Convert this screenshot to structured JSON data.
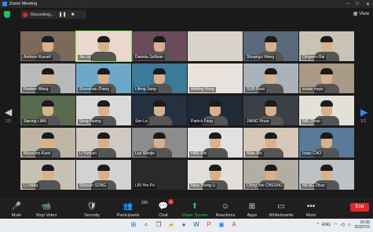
{
  "window": {
    "title": "Zoom Meeting",
    "controls": [
      "–",
      "□",
      "✕"
    ]
  },
  "recording": {
    "label": "Recording...",
    "view": "View"
  },
  "pager": {
    "left": "1/3",
    "right": "1/3"
  },
  "participants": [
    {
      "name": "Andrew Russell"
    },
    {
      "name": "Jie Liu"
    },
    {
      "name": "Daniela Sullivan"
    },
    {
      "name": ""
    },
    {
      "name": "Shuangyi Wang"
    },
    {
      "name": "Qingwen Bai"
    },
    {
      "name": "Ruimen Wang"
    },
    {
      "name": "Shanshan Zhang"
    },
    {
      "name": "Lifeng Jiang"
    },
    {
      "name": "Weiling Hong"
    },
    {
      "name": "SUN Ruixi"
    },
    {
      "name": "susan mays"
    },
    {
      "name": "Jiarong LIAN"
    },
    {
      "name": "Song Huang"
    },
    {
      "name": "Son Le"
    },
    {
      "name": "Patrick Fang"
    },
    {
      "name": "JIANG Yinuo"
    },
    {
      "name": "NIE Cihao"
    },
    {
      "name": "Miyazono Kaori"
    },
    {
      "name": "Li Yunyan"
    },
    {
      "name": "Luo Wenjie"
    },
    {
      "name": "HAN Wei"
    },
    {
      "name": "Allas Wu"
    },
    {
      "name": "Isaac CAO"
    },
    {
      "name": "Li Xiang"
    },
    {
      "name": "Shiyuan SONG"
    },
    {
      "name": "LIN Yen Po"
    },
    {
      "name": "Nora Yitong Li"
    },
    {
      "name": "Ching Yee CHEUNG"
    },
    {
      "name": "MENG Zihan"
    }
  ],
  "toolbar": {
    "mute": "Mute",
    "video": "Stop Video",
    "security": "Security",
    "participants": "Participants",
    "participants_count": "156",
    "chat": "Chat",
    "chat_badge": "3",
    "share": "Share Screen",
    "reactions": "Reactions",
    "apps": "Apps",
    "whiteboards": "Whiteboards",
    "more": "More",
    "end": "End"
  },
  "taskbar": {
    "lang": "ENG",
    "time": "10:36",
    "date": "2022/7/3"
  }
}
